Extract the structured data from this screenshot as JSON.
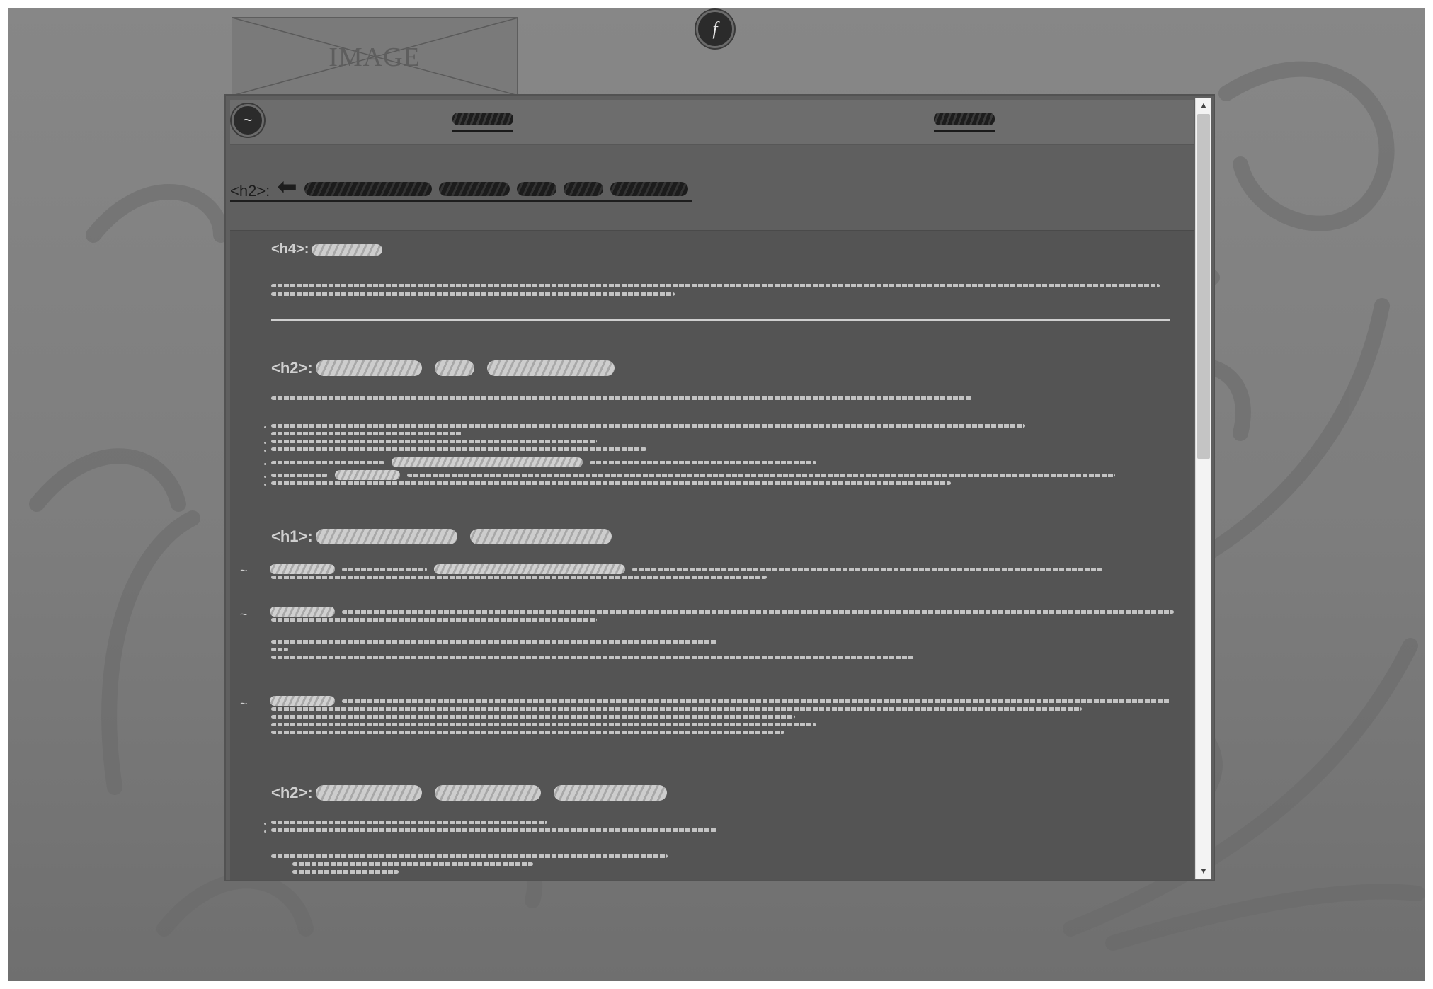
{
  "placeholder_image": {
    "label": "IMAGE"
  },
  "top_icon": {
    "glyph": "f",
    "name": "f-icon"
  },
  "nav": {
    "icon_glyph": "~",
    "links": [
      "",
      ""
    ]
  },
  "page": {
    "heading_tag": "<h2>:",
    "back_glyph": "⬅"
  },
  "content": {
    "sections": [
      {
        "tag": "<h4>:"
      },
      {
        "tag": "<h2>:"
      },
      {
        "tag": "<h1>:"
      },
      {
        "tag": "<h2>:"
      }
    ],
    "list_marker": "~"
  },
  "scrollbar": {
    "up_glyph": "▲",
    "down_glyph": "▼",
    "position": 0.0,
    "visible_fraction": 0.46
  },
  "colors": {
    "backdrop": "#808080",
    "panel": "#545454",
    "text_light": "#cfcfcf",
    "text_dark": "#1d1d1d"
  }
}
